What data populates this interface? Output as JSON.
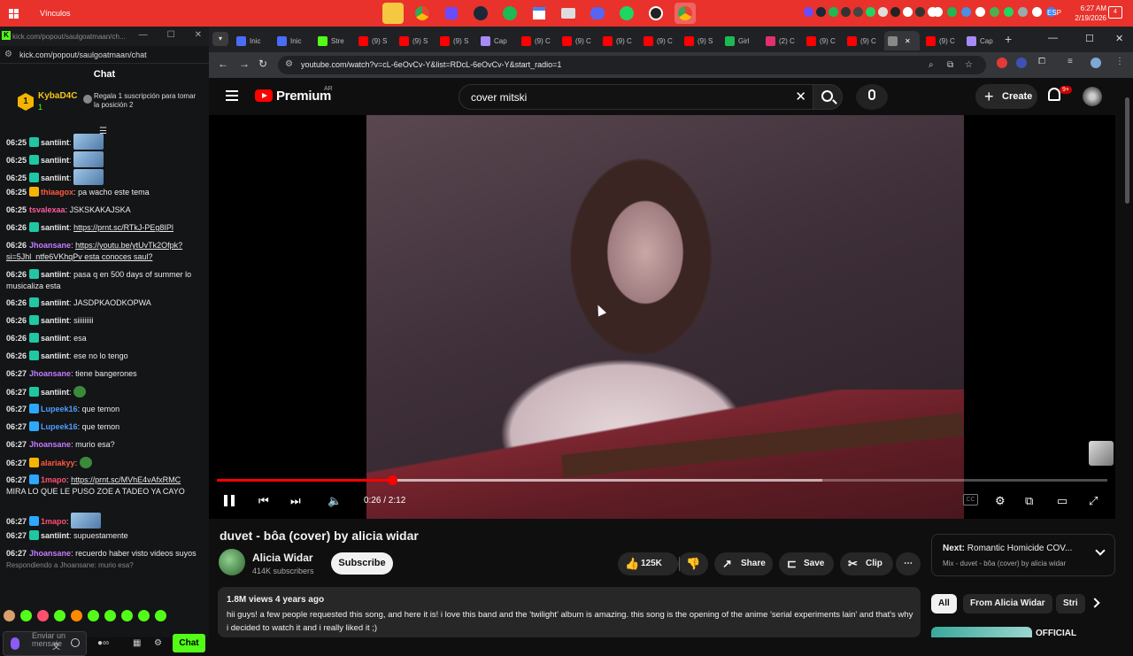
{
  "taskbar": {
    "title": "Vínculos",
    "lang": "ESP",
    "time": "6:27 AM",
    "date": "2/19/2026",
    "notif": "4"
  },
  "left_window": {
    "url_title": "kick.com/popout/saulgoatmaan/ch...",
    "url": "kick.com/popout/saulgoatmaan/chat",
    "chat_header": "Chat",
    "pinned": {
      "rank": "1",
      "name": "KybaD4C",
      "count": "1",
      "text": "Regala 1 suscripción para tomar la posición 2"
    },
    "messages": [
      {
        "time": "06:25",
        "user": "santiint",
        "color": "#e8e8e8",
        "badge": "#1fc7a3",
        "text": "",
        "emote": true
      },
      {
        "time": "06:25",
        "user": "santiint",
        "color": "#e8e8e8",
        "badge": "#1fc7a3",
        "text": "",
        "emote": true
      },
      {
        "time": "06:25",
        "user": "santiint",
        "color": "#e8e8e8",
        "badge": "#1fc7a3",
        "text": "",
        "emote": true
      },
      {
        "time": "06:25",
        "user": "thiaagox",
        "color": "#ff5a3c",
        "badge": "#f5b400",
        "text": "pa wacho este tema"
      },
      {
        "time": "06:25",
        "user": "tsvalexaa",
        "color": "#ff5a9c",
        "badge": "",
        "text": "JSKSKAKAJSKA"
      },
      {
        "time": "06:26",
        "user": "santiint",
        "color": "#e8e8e8",
        "badge": "#1fc7a3",
        "text": "https://prnt.sc/RTkJ-PEg8IPl",
        "link": true
      },
      {
        "time": "06:26",
        "user": "Jhoansane",
        "color": "#c57bff",
        "badge": "",
        "text": "https://youtu.be/ytUvTk2Ofpk?si=5Jhl_ntfe6VKhqPv esta conoces saul?",
        "link": true
      },
      {
        "time": "06:26",
        "user": "santiint",
        "color": "#e8e8e8",
        "badge": "#1fc7a3",
        "text": "pasa q en 500 days of summer lo musicaliza esta"
      },
      {
        "time": "06:26",
        "user": "santiint",
        "color": "#e8e8e8",
        "badge": "#1fc7a3",
        "text": "JASDPKAODKOPWA"
      },
      {
        "time": "06:26",
        "user": "santiint",
        "color": "#e8e8e8",
        "badge": "#1fc7a3",
        "text": "siiiiiiiii"
      },
      {
        "time": "06:26",
        "user": "santiint",
        "color": "#e8e8e8",
        "badge": "#1fc7a3",
        "text": "esa"
      },
      {
        "time": "06:26",
        "user": "santiint",
        "color": "#e8e8e8",
        "badge": "#1fc7a3",
        "text": "ese no lo tengo"
      },
      {
        "time": "06:27",
        "user": "Jhoansane",
        "color": "#c57bff",
        "badge": "",
        "text": "tiene bangerones"
      },
      {
        "time": "06:27",
        "user": "santiint",
        "color": "#e8e8e8",
        "badge": "#1fc7a3",
        "text": ""
      },
      {
        "time": "06:27",
        "user": "Lupeek16",
        "color": "#4f9dff",
        "badge": "#2da8ff",
        "text": "que temon"
      },
      {
        "time": "06:27",
        "user": "Lupeek16",
        "color": "#4f9dff",
        "badge": "#2da8ff",
        "text": "que temon"
      },
      {
        "time": "06:27",
        "user": "Jhoansane",
        "color": "#c57bff",
        "badge": "",
        "text": "murio esa?"
      },
      {
        "time": "06:27",
        "user": "alariakyy",
        "color": "#ff5a3c",
        "badge": "#f5b400",
        "text": ""
      },
      {
        "time": "06:27",
        "user": "1mapo",
        "color": "#ff4f6e",
        "badge": "#2da8ff",
        "text": "https://prnt.sc/MVhE4vAfxRMC",
        "link": true,
        "extra": "MIRA LO QUE LE PUSO ZOE A TADEO YA CAYO"
      },
      {
        "time": "06:27",
        "user": "1mapo",
        "color": "#ff4f6e",
        "badge": "#2da8ff",
        "text": "",
        "emote": true
      },
      {
        "time": "06:27",
        "user": "santiint",
        "color": "#e8e8e8",
        "badge": "#1fc7a3",
        "text": "supuestamente"
      },
      {
        "time": "06:27",
        "user": "Jhoansane",
        "color": "#c57bff",
        "badge": "",
        "text": "recuerdo haber visto videos suyos"
      }
    ],
    "reply_hint": "Respondiendo a Jhoansane: murio esa?",
    "input_placeholder": "Enviar un mensaje",
    "chat_button": "Chat"
  },
  "browser": {
    "tabs": [
      "Inic",
      "Inic",
      "Stre",
      "(9) S",
      "(9) S",
      "(9) S",
      "Cap",
      "(9) C",
      "(9) C",
      "(9) C",
      "(9) C",
      "(9) S",
      "Girl",
      "(2) C",
      "(9) C",
      "(9) C",
      "",
      "(9) C",
      "Cap"
    ],
    "url": "youtube.com/watch?v=cL-6eOvCv-Y&list=RDcL-6eOvCv-Y&start_radio=1"
  },
  "youtube": {
    "brand": "Premium",
    "country": "AR",
    "search_value": "cover mitski",
    "create_label": "Create",
    "notif_badge": "9+",
    "player": {
      "time": "0:26 / 2:12",
      "progress": 0.197,
      "buffered": 0.68
    },
    "video_title": "duvet - bôa (cover) by alicia widar",
    "channel": {
      "name": "Alicia Widar",
      "subs": "414K subscribers",
      "subscribe_label": "Subscribe"
    },
    "actions": {
      "likes": "125K",
      "share": "Share",
      "save": "Save",
      "clip": "Clip"
    },
    "description": {
      "meta": "1.8M views  4 years ago",
      "text": "hii guys! a few people requested this song, and here it is! i love this band and the 'twilight' album is amazing. this song is the opening of the anime 'serial experiments lain' and that's why i decided to watch it and i really liked it ;)"
    },
    "next_up": {
      "label": "Next:",
      "title": "Romantic Homicide COV...",
      "sub": "Mix - duvet - bôa (cover) by alicia widar"
    },
    "chips": [
      "All",
      "From Alicia Widar",
      "Stri"
    ],
    "rec_title": "OFFICIAL"
  }
}
